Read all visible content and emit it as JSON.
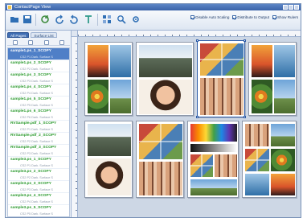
{
  "window": {
    "title": "ContactPage View"
  },
  "toolbar": {
    "buttons": [
      {
        "name": "open-icon",
        "color": "#2f6fb5"
      },
      {
        "name": "save-icon",
        "color": "#2f6fb5"
      },
      {
        "name": "refresh-icon",
        "color": "#3b8a3b"
      },
      {
        "name": "rotate-left-icon",
        "color": "#2f6fb5"
      },
      {
        "name": "rotate-right-icon",
        "color": "#2f6fb5"
      },
      {
        "name": "text-icon",
        "color": "#2f9a8a"
      },
      {
        "name": "layout-icon",
        "color": "#2f6fb5"
      },
      {
        "name": "zoom-icon",
        "color": "#2f6fb5"
      },
      {
        "name": "settings-icon",
        "color": "#2f6fb5"
      }
    ],
    "checkboxes": [
      {
        "label": "Disable Auto Scaling",
        "checked": true
      },
      {
        "label": "Distribute to Output",
        "checked": true
      },
      {
        "label": "Show Rulers",
        "checked": true
      }
    ]
  },
  "sidebar": {
    "tabs": [
      "All Pages",
      "Surface List"
    ],
    "active_tab": 0,
    "files": [
      {
        "name": "sample1.ps_1_SCOPY",
        "info": "CS2 P1 Dark. Surface S",
        "selected": true
      },
      {
        "name": "sample1.ps_2_SCOPY",
        "info": "CS2 P2 Dark. Surface S",
        "selected": false
      },
      {
        "name": "sample1.ps_3_SCOPY",
        "info": "CS2 P3 Dark. Surface S",
        "selected": false
      },
      {
        "name": "sample1.ps_4_SCOPY",
        "info": "CS2 P4 Dark. Surface S",
        "selected": false
      },
      {
        "name": "sample1.ps_5_SCOPY",
        "info": "CS2 P5 Dark. Surface S",
        "selected": false
      },
      {
        "name": "sample1.ps_6_SCOPY",
        "info": "CS2 P6 Dark. Surface S",
        "selected": false
      },
      {
        "name": "RVSample.pdf_1_SCOPY",
        "info": "CS2 P1 Dark. Surface S",
        "selected": false
      },
      {
        "name": "RVSample.pdf_2_SCOPY",
        "info": "CS2 P2 Dark. Surface S",
        "selected": false
      },
      {
        "name": "RVSample.pdf_3_SCOPY",
        "info": "CS2 P3 Dark. Surface S",
        "selected": false
      },
      {
        "name": "sample3.ps_1_SCOPY",
        "info": "CS2 P1 Dark. Surface S",
        "selected": false
      },
      {
        "name": "sample3.ps_2_SCOPY",
        "info": "CS2 P2 Dark. Surface S",
        "selected": false
      },
      {
        "name": "sample3.ps_3_SCOPY",
        "info": "CS2 P3 Dark. Surface S",
        "selected": false
      },
      {
        "name": "sample3.ps_4_SCOPY",
        "info": "CS2 P4 Dark. Surface S",
        "selected": false
      },
      {
        "name": "sample3.ps_5_SCOPY",
        "info": "CS2 P5 Dark. Surface S",
        "selected": false
      }
    ]
  },
  "colors": {
    "accent": "#3f6db3",
    "filename": "#2b9a2e"
  }
}
